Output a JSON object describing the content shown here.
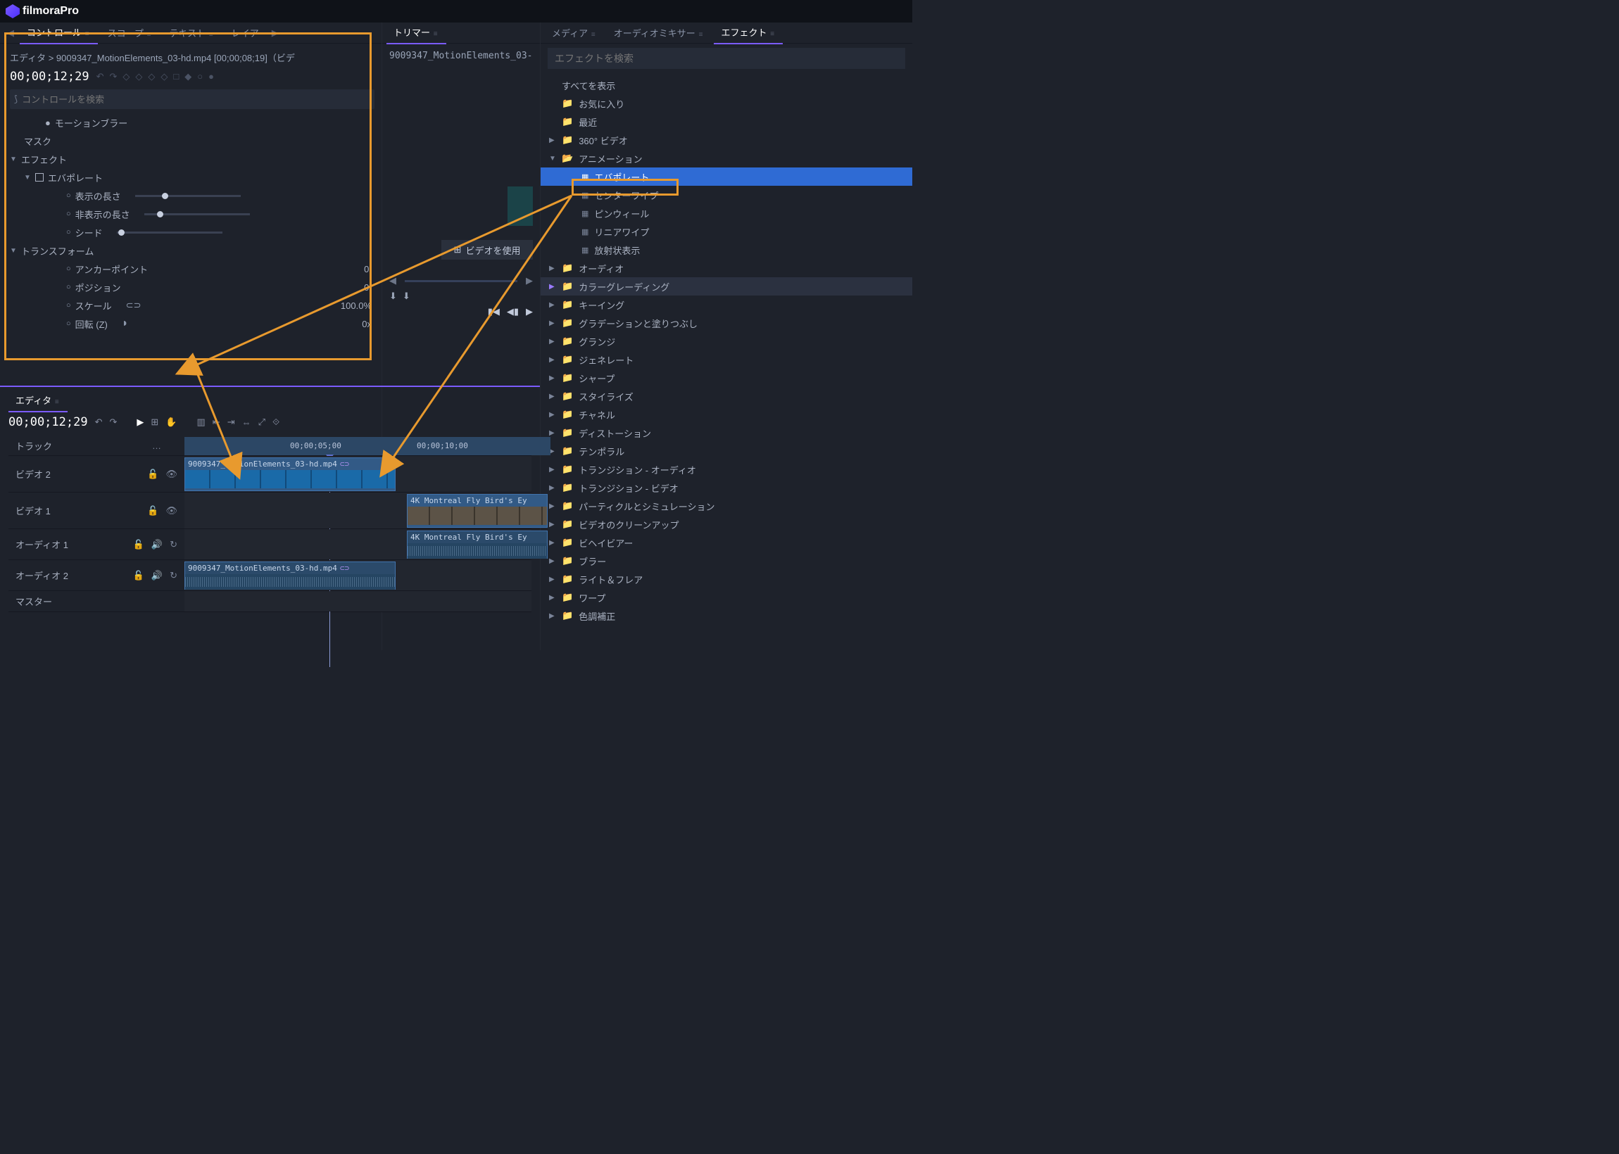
{
  "app": {
    "name": "filmoraPro"
  },
  "topTabs": {
    "control": "コントロール",
    "scope": "スコープ",
    "text": "テキスト",
    "layer": "レイア"
  },
  "midTab": {
    "trimmer": "トリマー"
  },
  "rightTabs": {
    "media": "メディア",
    "audioMixer": "オーディオミキサー",
    "effects": "エフェクト"
  },
  "breadcrumb": "エディタ > 9009347_MotionElements_03-hd.mp4 [00;00;08;19]（ビデ",
  "controls": {
    "timecode": "00;00;12;29",
    "searchPlaceholder": "コントロールを検索",
    "motionBlur": "モーションブラー",
    "mask": "マスク",
    "effects": "エフェクト",
    "evaporate": "エバポレート",
    "showLength": "表示の長さ",
    "hideLength": "非表示の長さ",
    "seed": "シード",
    "transform": "トランスフォーム",
    "anchorPoint": "アンカーポイント",
    "position": "ポジション",
    "scale": "スケール",
    "scaleVal": "100.0%",
    "rotation": "回転 (Z)",
    "rotationVal": "0x",
    "zeroDot": "0."
  },
  "trimmer": {
    "file": "9009347_MotionElements_03-",
    "useVideo": "ビデオを使用"
  },
  "editor": {
    "title": "エディタ",
    "timecode": "00;00;12;29",
    "trackHeader": "トラック",
    "ruler1": "00;00;05;00",
    "ruler2": "00;00;10;00",
    "tracks": {
      "video2": "ビデオ 2",
      "video1": "ビデオ 1",
      "audio1": "オーディオ 1",
      "audio2": "オーディオ 2",
      "master": "マスター"
    },
    "clip1": "9009347_MotionElements_03-hd.mp4",
    "clip2": "4K Montreal Fly Bird's Ey",
    "clip3": "4K Montreal Fly Bird's Ey",
    "clip4": "9009347_MotionElements_03-hd.mp4"
  },
  "fx": {
    "searchPlaceholder": "エフェクトを検索",
    "showAll": "すべてを表示",
    "favorites": "お気に入り",
    "recent": "最近",
    "video360": "360° ビデオ",
    "animation": "アニメーション",
    "evaporate": "エバポレート",
    "centerWipe": "センターワイプ",
    "pinwheel": "ピンウィール",
    "linearWipe": "リニアワイプ",
    "radial": "放射状表示",
    "audio": "オーディオ",
    "colorGrading": "カラーグレーディング",
    "keying": "キーイング",
    "gradient": "グラデーションと塗りつぶし",
    "grunge": "グランジ",
    "generate": "ジェネレート",
    "sharpen": "シャープ",
    "stylize": "スタイライズ",
    "channel": "チャネル",
    "distortion": "ディストーション",
    "temporal": "テンポラル",
    "transAudio": "トランジション - オーディオ",
    "transVideo": "トランジション - ビデオ",
    "particle": "パーティクルとシミュレーション",
    "cleanup": "ビデオのクリーンアップ",
    "behavior": "ビヘイビアー",
    "blur": "ブラー",
    "light": "ライト＆フレア",
    "warp": "ワープ",
    "colorCorrect": "色調補正"
  }
}
